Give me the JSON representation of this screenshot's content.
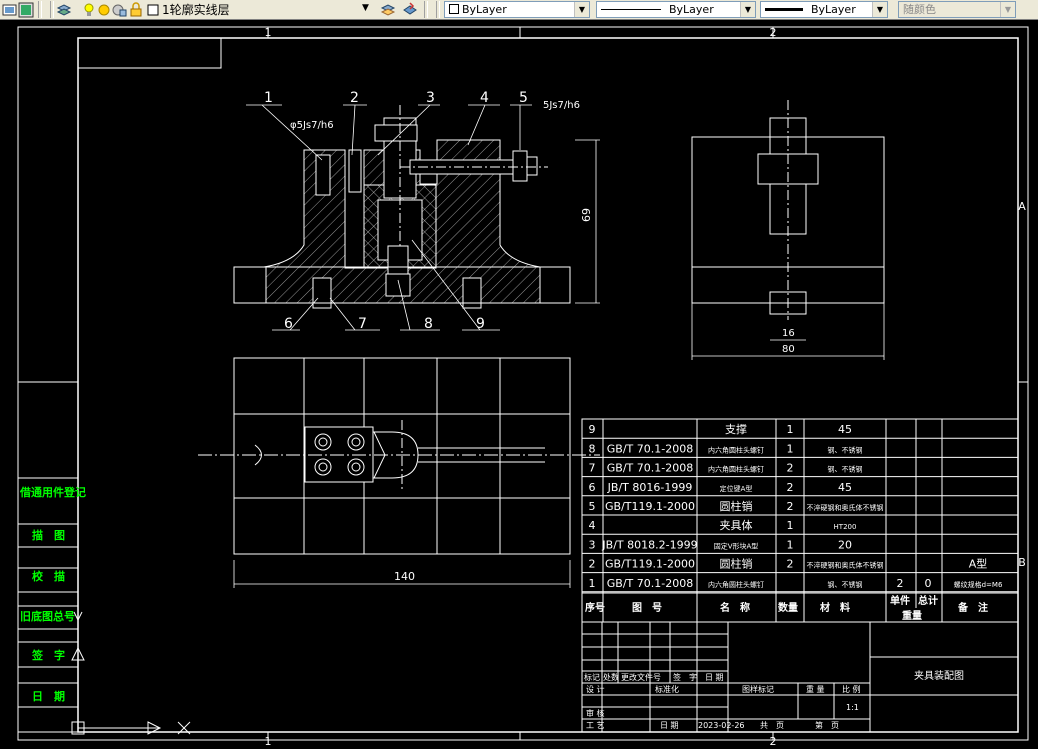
{
  "toolbar": {
    "layer_name": "1轮廓实线层",
    "color": "ByLayer",
    "linetype": "ByLayer",
    "lineweight": "ByLayer",
    "plotstyle": "随颜色"
  },
  "drawing": {
    "zone_top": [
      "1",
      "2"
    ],
    "zone_bottom": [
      "1",
      "2"
    ],
    "zone_right": [
      "A",
      "B"
    ],
    "balloons": [
      "1",
      "2",
      "3",
      "4",
      "5",
      "6",
      "7",
      "8",
      "9"
    ],
    "tol_left": "φ5Js7/h6",
    "tol_right": "5Js7/h6",
    "dim_height": "69",
    "dim_width": "140",
    "dim_side_small": "16",
    "dim_side_width": "80",
    "side_fields": [
      "借通用件登记",
      "描　图",
      "校　描",
      "旧底图总号",
      "签　字",
      "日　期"
    ],
    "bom_header": [
      "序号",
      "图　号",
      "名　称",
      "数量",
      "材　料",
      "单件",
      "总计",
      "重量",
      "备　注"
    ],
    "bom_rows": [
      [
        "9",
        "",
        "支撑",
        "1",
        "45",
        "",
        "",
        ""
      ],
      [
        "8",
        "GB/T 70.1-2008",
        "内六角圆柱头螺钉",
        "1",
        "钢、不锈钢",
        "",
        "",
        ""
      ],
      [
        "7",
        "GB/T 70.1-2008",
        "内六角圆柱头螺钉",
        "2",
        "钢、不锈钢",
        "",
        "",
        ""
      ],
      [
        "6",
        "JB/T 8016-1999",
        "定位键A型",
        "2",
        "45",
        "",
        "",
        ""
      ],
      [
        "5",
        "GB/T119.1-2000",
        "圆柱销",
        "2",
        "不淬硬钢和奥氏体不锈钢",
        "",
        "",
        ""
      ],
      [
        "4",
        "",
        "夹具体",
        "1",
        "HT200",
        "",
        "",
        ""
      ],
      [
        "3",
        "JB/T 8018.2-1999",
        "固定V形块A型",
        "1",
        "20",
        "",
        "",
        ""
      ],
      [
        "2",
        "GB/T119.1-2000",
        "圆柱销",
        "2",
        "不淬硬钢和奥氏体不锈钢",
        "",
        "",
        "A型"
      ],
      [
        "1",
        "GB/T 70.1-2008",
        "内六角圆柱头螺钉",
        "",
        "钢、不锈钢",
        "2",
        "0",
        "螺纹规格d=M6"
      ]
    ],
    "title_cells": {
      "row1": [
        "标记",
        "处数",
        "更改文件号",
        "签　字",
        "日 期"
      ],
      "design": "设 计",
      "std": "标准化",
      "check": "审 核",
      "process": "工 艺",
      "date_label": "日 期",
      "date_value": "2023-02-26",
      "stage_mark": "图样标记",
      "weight": "重 量",
      "scale": "比 例",
      "scale_value": "1:1",
      "sheets": "共　页",
      "sheet": "第　页",
      "drawing_title": "夹具装配图"
    }
  }
}
